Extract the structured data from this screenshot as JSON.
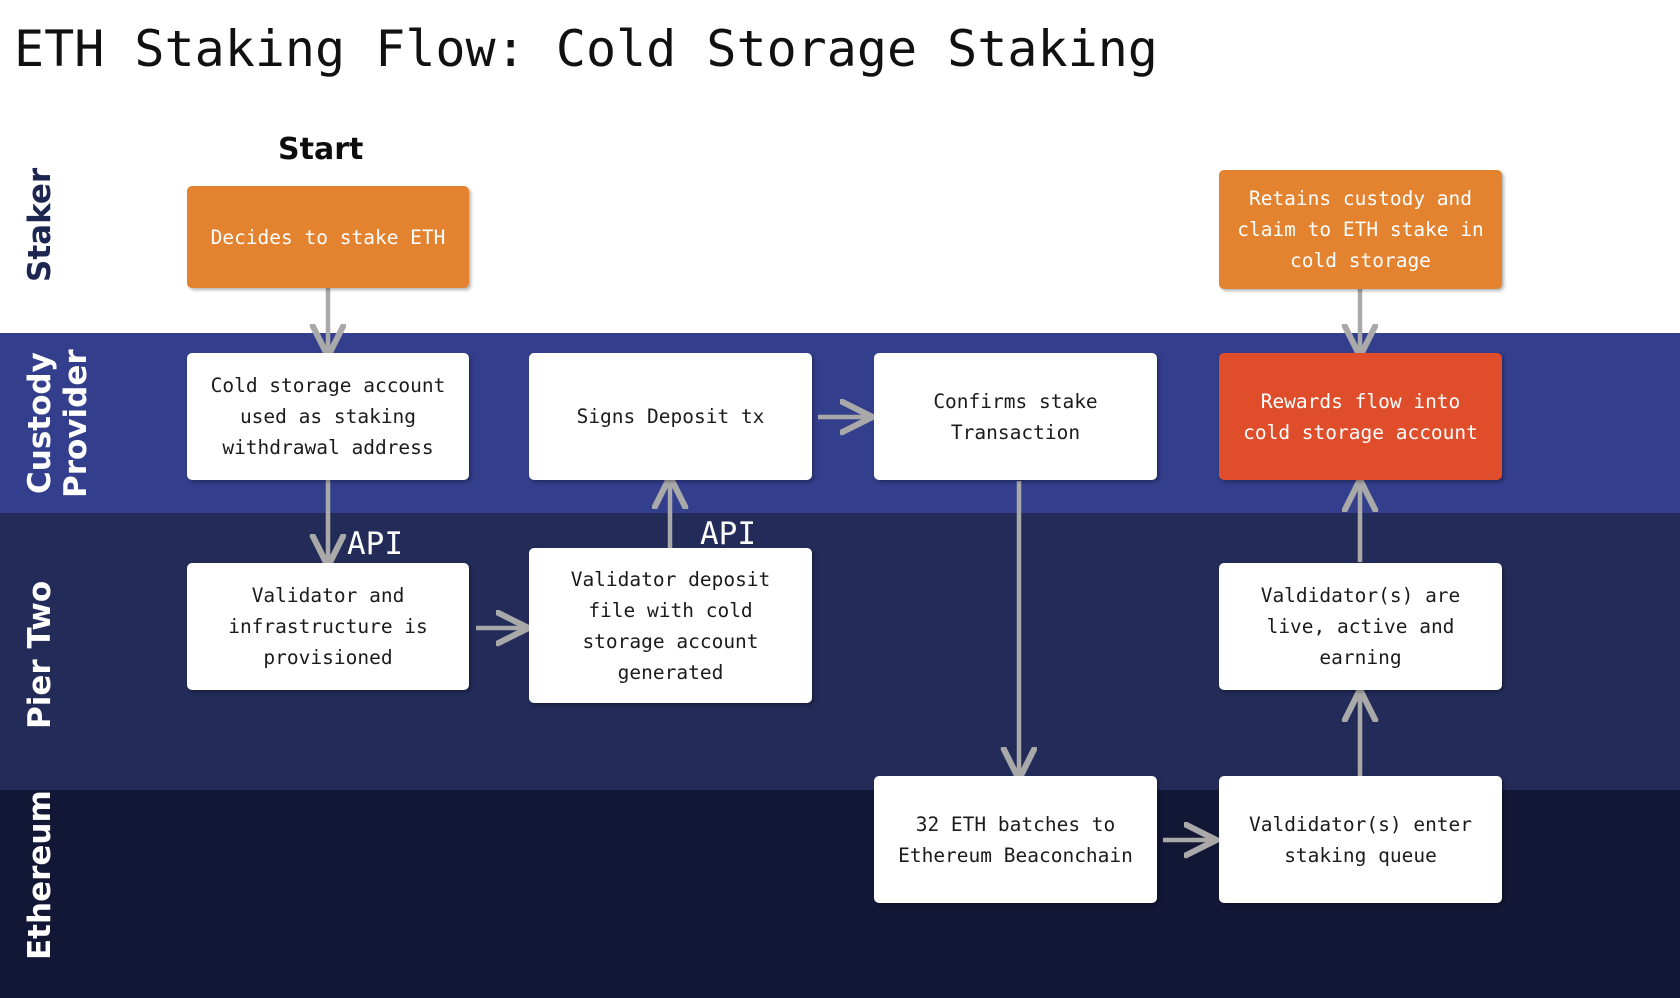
{
  "title": "ETH Staking Flow: Cold Storage Staking",
  "colors": {
    "staker_lane_bg": "#ffffff",
    "custody_lane_bg": "#333e8c",
    "pier_lane_bg": "#232b58",
    "ethereum_lane_bg": "#131736",
    "orange_node": "#e3822f",
    "red_node": "#e04d2b",
    "white_node": "#ffffff",
    "arrow": "#a9a9a9",
    "staker_label_text": "#1d2651"
  },
  "lanes": [
    {
      "id": "staker",
      "label": "Staker"
    },
    {
      "id": "custody",
      "label": "Custody\nProvider"
    },
    {
      "id": "pier",
      "label": "Pier Two"
    },
    {
      "id": "ethereum",
      "label": "Ethereum"
    }
  ],
  "annotations": {
    "start": "Start",
    "api_1": "API",
    "api_2": "API"
  },
  "nodes": [
    {
      "id": "decides",
      "lane": "staker",
      "style": "orange",
      "text": "Decides to stake ETH"
    },
    {
      "id": "retains",
      "lane": "staker",
      "style": "orange",
      "text": "Retains custody and\nclaim to ETH stake in\ncold storage"
    },
    {
      "id": "cold-storage",
      "lane": "custody",
      "style": "white",
      "text": "Cold storage account\nused as staking\nwithdrawal address"
    },
    {
      "id": "signs-deposit",
      "lane": "custody",
      "style": "white",
      "text": "Signs Deposit tx"
    },
    {
      "id": "confirms-stake",
      "lane": "custody",
      "style": "white",
      "text": "Confirms stake\nTransaction"
    },
    {
      "id": "rewards-flow",
      "lane": "custody",
      "style": "red",
      "text": "Rewards flow into\ncold storage account"
    },
    {
      "id": "validator-prov",
      "lane": "pier",
      "style": "white",
      "text": "Validator and\ninfrastructure is\nprovisioned"
    },
    {
      "id": "deposit-file",
      "lane": "pier",
      "style": "white",
      "text": "Validator deposit\nfile with cold\nstorage account\ngenerated"
    },
    {
      "id": "validators-live",
      "lane": "pier",
      "style": "white",
      "text": "Valdidator(s) are\nlive, active and\nearning"
    },
    {
      "id": "eth-batches",
      "lane": "ethereum",
      "style": "white",
      "text": "32 ETH batches to\nEthereum Beaconchain"
    },
    {
      "id": "staking-queue",
      "lane": "ethereum",
      "style": "white",
      "text": "Valdidator(s) enter\nstaking queue"
    }
  ],
  "edges": [
    {
      "from": "decides",
      "to": "cold-storage",
      "label": ""
    },
    {
      "from": "cold-storage",
      "to": "validator-prov",
      "label": "API"
    },
    {
      "from": "validator-prov",
      "to": "deposit-file",
      "label": ""
    },
    {
      "from": "deposit-file",
      "to": "signs-deposit",
      "label": "API"
    },
    {
      "from": "signs-deposit",
      "to": "confirms-stake",
      "label": ""
    },
    {
      "from": "confirms-stake",
      "to": "eth-batches",
      "label": ""
    },
    {
      "from": "eth-batches",
      "to": "staking-queue",
      "label": ""
    },
    {
      "from": "staking-queue",
      "to": "validators-live",
      "label": ""
    },
    {
      "from": "validators-live",
      "to": "rewards-flow",
      "label": ""
    },
    {
      "from": "retains",
      "to": "rewards-flow",
      "label": ""
    }
  ]
}
